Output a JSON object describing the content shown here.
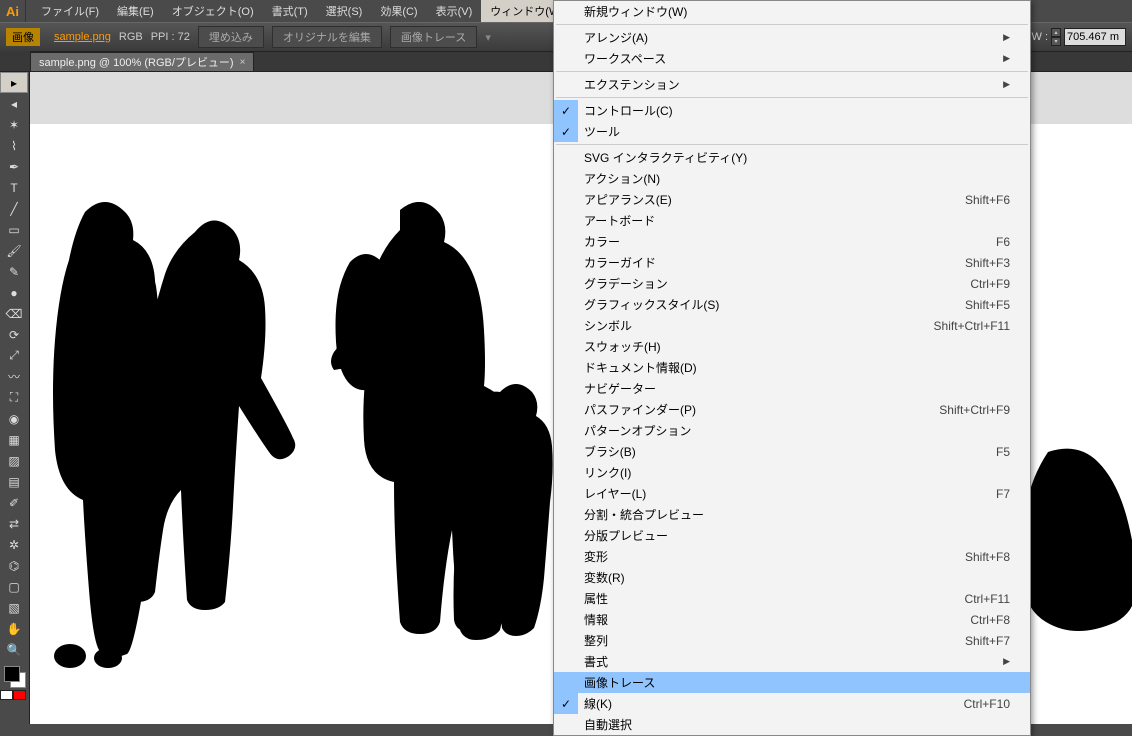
{
  "app": {
    "logo": "Ai"
  },
  "menubar": {
    "items": [
      "ファイル(F)",
      "編集(E)",
      "オブジェクト(O)",
      "書式(T)",
      "選択(S)",
      "効果(C)",
      "表示(V)",
      "ウィンドウ(W)"
    ],
    "open_index": 7
  },
  "controlbar": {
    "mode_label": "画像",
    "link_text": "sample.png",
    "color_mode": "RGB",
    "ppi": "PPI : 72",
    "btn_embed": "埋め込み",
    "btn_edit_original": "オリジナルを編集",
    "btn_image_trace": "画像トレース",
    "w_label": "W :",
    "w_value": "705.467 m"
  },
  "doctab": {
    "title": "sample.png @ 100% (RGB/プレビュー)",
    "close": "×"
  },
  "tools": {
    "items": [
      "selection-tool",
      "direct-selection-tool",
      "magic-wand-tool",
      "lasso-tool",
      "pen-tool",
      "type-tool",
      "line-tool",
      "rectangle-tool",
      "paintbrush-tool",
      "pencil-tool",
      "blob-brush-tool",
      "eraser-tool",
      "rotate-tool",
      "scale-tool",
      "width-tool",
      "free-transform-tool",
      "shape-builder-tool",
      "perspective-tool",
      "mesh-tool",
      "gradient-tool",
      "eyedropper-tool",
      "blend-tool",
      "symbol-sprayer-tool",
      "graph-tool",
      "artboard-tool",
      "slice-tool",
      "hand-tool",
      "zoom-tool"
    ],
    "glyphs": [
      "▸",
      "◂",
      "✶",
      "⌇",
      "✒",
      "T",
      "╱",
      "▭",
      "🖌",
      "✎",
      "●",
      "⌫",
      "⟳",
      "⤢",
      "〰",
      "⛶",
      "◉",
      "▦",
      "▨",
      "▤",
      "✐",
      "⇄",
      "✲",
      "⌬",
      "▢",
      "▧",
      "✋",
      "🔍"
    ],
    "selected_index": 0
  },
  "window_menu": {
    "groups": [
      [
        {
          "label": "新規ウィンドウ(W)"
        }
      ],
      [
        {
          "label": "アレンジ(A)",
          "submenu": true
        },
        {
          "label": "ワークスペース",
          "submenu": true
        }
      ],
      [
        {
          "label": "エクステンション",
          "submenu": true
        }
      ],
      [
        {
          "label": "コントロール(C)",
          "checked": true
        },
        {
          "label": "ツール",
          "checked": true
        }
      ],
      [
        {
          "label": "SVG インタラクティビティ(Y)"
        },
        {
          "label": "アクション(N)"
        },
        {
          "label": "アピアランス(E)",
          "shortcut": "Shift+F6"
        },
        {
          "label": "アートボード"
        },
        {
          "label": "カラー",
          "shortcut": "F6"
        },
        {
          "label": "カラーガイド",
          "shortcut": "Shift+F3"
        },
        {
          "label": "グラデーション",
          "shortcut": "Ctrl+F9"
        },
        {
          "label": "グラフィックスタイル(S)",
          "shortcut": "Shift+F5"
        },
        {
          "label": "シンボル",
          "shortcut": "Shift+Ctrl+F11"
        },
        {
          "label": "スウォッチ(H)"
        },
        {
          "label": "ドキュメント情報(D)"
        },
        {
          "label": "ナビゲーター"
        },
        {
          "label": "パスファインダー(P)",
          "shortcut": "Shift+Ctrl+F9"
        },
        {
          "label": "パターンオプション"
        },
        {
          "label": "ブラシ(B)",
          "shortcut": "F5"
        },
        {
          "label": "リンク(I)"
        },
        {
          "label": "レイヤー(L)",
          "shortcut": "F7"
        },
        {
          "label": "分割・統合プレビュー"
        },
        {
          "label": "分版プレビュー"
        },
        {
          "label": "変形",
          "shortcut": "Shift+F8"
        },
        {
          "label": "変数(R)"
        },
        {
          "label": "属性",
          "shortcut": "Ctrl+F11"
        },
        {
          "label": "情報",
          "shortcut": "Ctrl+F8"
        },
        {
          "label": "整列",
          "shortcut": "Shift+F7"
        },
        {
          "label": "書式",
          "submenu": true
        },
        {
          "label": "画像トレース",
          "highlight": true
        },
        {
          "label": "線(K)",
          "checked": true,
          "shortcut": "Ctrl+F10"
        },
        {
          "label": "自動選択"
        }
      ]
    ]
  }
}
